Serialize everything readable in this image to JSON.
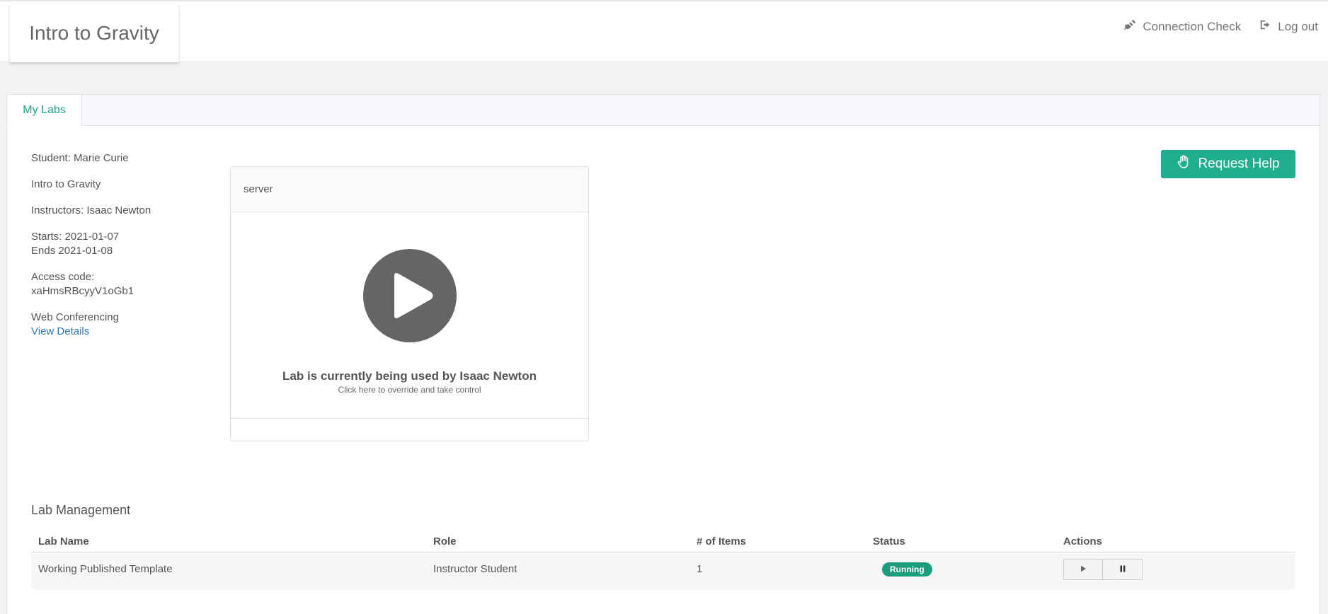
{
  "header": {
    "title": "Intro to Gravity",
    "links": {
      "connection_check": "Connection Check",
      "logout": "Log out"
    }
  },
  "tabs": {
    "my_labs": "My Labs"
  },
  "info": {
    "student": "Student: Marie Curie",
    "course": "Intro to Gravity",
    "instructors": "Instructors: Isaac Newton",
    "starts": "Starts: 2021-01-07",
    "ends": "Ends 2021-01-08",
    "access_label": "Access code:",
    "access_code": "xaHmsRBcyyV1oGb1",
    "web_conf": "Web Conferencing",
    "view_details": "View Details"
  },
  "server": {
    "name": "server",
    "message": "Lab is currently being used by Isaac Newton",
    "sub_message": "Click here to override and take control"
  },
  "help": {
    "label": "Request Help"
  },
  "management": {
    "title": "Lab Management",
    "columns": [
      "Lab Name",
      "Role",
      "# of Items",
      "Status",
      "Actions"
    ],
    "rows": [
      {
        "lab_name": "Working Published Template",
        "role": "Instructor Student",
        "items": "1",
        "status": "Running"
      }
    ]
  },
  "colors": {
    "accent": "#1fae8e",
    "status_running": "#1a9d7c",
    "link": "#2a7abf"
  },
  "icons": {
    "connection_check": "plug-icon",
    "logout": "sign-out-icon",
    "help": "hand-icon",
    "play": "play-icon",
    "pause": "pause-icon"
  }
}
